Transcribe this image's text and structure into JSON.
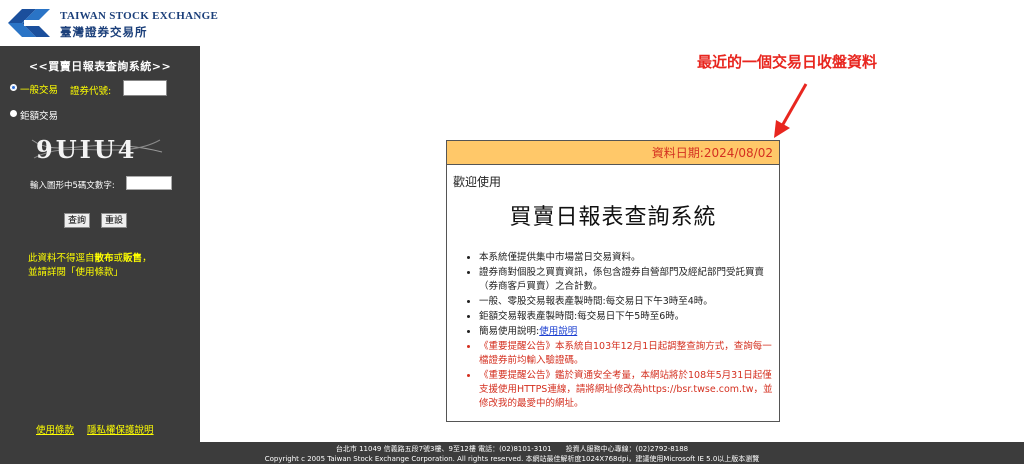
{
  "header": {
    "logo_en": "TAIWAN STOCK EXCHANGE",
    "logo_zh": "臺灣證券交易所",
    "logo_color": "#1b3f7a"
  },
  "sidebar": {
    "title": "<<買賣日報表查詢系統>>",
    "option_general": "一般交易",
    "stock_code_label": "證券代號:",
    "stock_code_value": "",
    "option_block": "鉅額交易",
    "captcha_text": "9UIU4",
    "captcha_label": "輸入圖形中5碼文數字:",
    "captcha_value": "",
    "query_button": "查詢",
    "reset_button": "重設",
    "notice_line1_prefix": "此資料不得逕自",
    "notice_bold1": "散布",
    "notice_mid": "或",
    "notice_bold2": "販售",
    "notice_line1_suffix": "，",
    "notice_line2": "並請詳閱「使用條款」",
    "link_terms": "使用條款",
    "link_privacy": "隱私權保護說明",
    "bg_color": "#3c3c3c",
    "accent_color": "#ffff00"
  },
  "annotation": {
    "text": "最近的一個交易日收盤資料",
    "color": "#e8261f"
  },
  "panel": {
    "data_date": "資料日期:2024/08/02",
    "welcome": "歡迎使用",
    "big_title": "買賣日報表查詢系統",
    "note1": "本系統僅提供集中市場當日交易資料。",
    "note2": "證券商對個股之買賣資訊，係包含證券自營部門及經紀部門受託買賣（券商客戶買賣）之合計數。",
    "note3": "一般、零股交易報表產製時間:每交易日下午3時至4時。",
    "note4": "鉅額交易報表產製時間:每交易日下午5時至6時。",
    "note5_prefix": "簡易使用說明:",
    "note5_link": "使用說明",
    "note6": "《重要提醒公告》本系統自103年12月1日起調整查詢方式，查詢每一檔證券前均輸入驗證碼。",
    "note7": "《重要提醒公告》鑑於資通安全考量，本網站將於108年5月31日起僅支援使用HTTPS連線，請將網址修改為https://bsr.twse.com.tw，並修改我的最愛中的網址。",
    "header_color": "#ffc869",
    "date_color": "#d43020"
  },
  "footer": {
    "line1": "台北市 11049 信義路五段7號3樓、9至12樓 電話：(02)8101-3101　　投資人服務中心專線：(02)2792-8188",
    "line2": "Copyright c 2005 Taiwan Stock Exchange Corporation. All rights reserved. 本網站最佳解析度1024X768dpi，建議使用Microsoft IE 5.0以上版本瀏覽"
  }
}
